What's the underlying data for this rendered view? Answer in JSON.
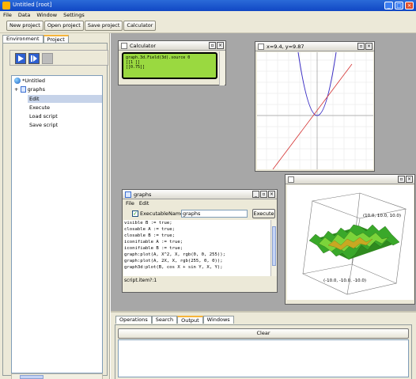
{
  "window": {
    "title": "Untitled [root]",
    "controls": [
      "_",
      "□",
      "×"
    ]
  },
  "menubar": {
    "items": [
      "File",
      "Data",
      "Window",
      "Settings"
    ]
  },
  "toolbar": {
    "new_project": "New project",
    "open_project": "Open project",
    "save_project": "Save project",
    "calculator": "Calculator"
  },
  "left_tabs": [
    "Environment",
    "Project"
  ],
  "tree": {
    "root": "*Untitled",
    "expand_toggle": "+",
    "node": "graphs",
    "items": [
      "Edit",
      "Execute",
      "Load script",
      "Save script"
    ]
  },
  "calculator": {
    "title": "Calculator",
    "display_lines": [
      "graph.3d.Field(3d).source 0",
      "  [[1    ]]",
      "  [[0.75]]"
    ]
  },
  "graph2d": {
    "coord_label": "x=9.4,  y=9.87"
  },
  "graphs_editor": {
    "title": "graphs",
    "menu": [
      "File",
      "Edit"
    ],
    "executable_label": "Executable",
    "name_label": "Name",
    "name_value": "graphs",
    "execute_button": "Execute",
    "code_lines": [
      "visible B := true;",
      "closable A := true;",
      "closable B := true;",
      "iconifiable A := true;",
      "iconifiable B := true;",
      "graph:plot(A, X^2, X, rgb(0, 0, 255));",
      "graph:plot(A, 2X, X, rgb(255, 0, 0));",
      "graph3d:plot(B, cos X + sin Y, X, Y);"
    ],
    "status": "script.item?:1"
  },
  "graph3d": {
    "corner_top": "(10.0, 10.0, 10.0)",
    "corner_bottom": "(-10.0, -10.0, -10.0)"
  },
  "bottom_tabs": [
    "Operations",
    "Search",
    "Output",
    "Windows"
  ],
  "clear_button": "Clear",
  "colors": {
    "title_blue": "#1147c4",
    "lcd_green": "#9ad940",
    "desktop_gray": "#a7a7a7",
    "parabola_blue": "#3b2ec4",
    "line_red": "#d43030"
  }
}
